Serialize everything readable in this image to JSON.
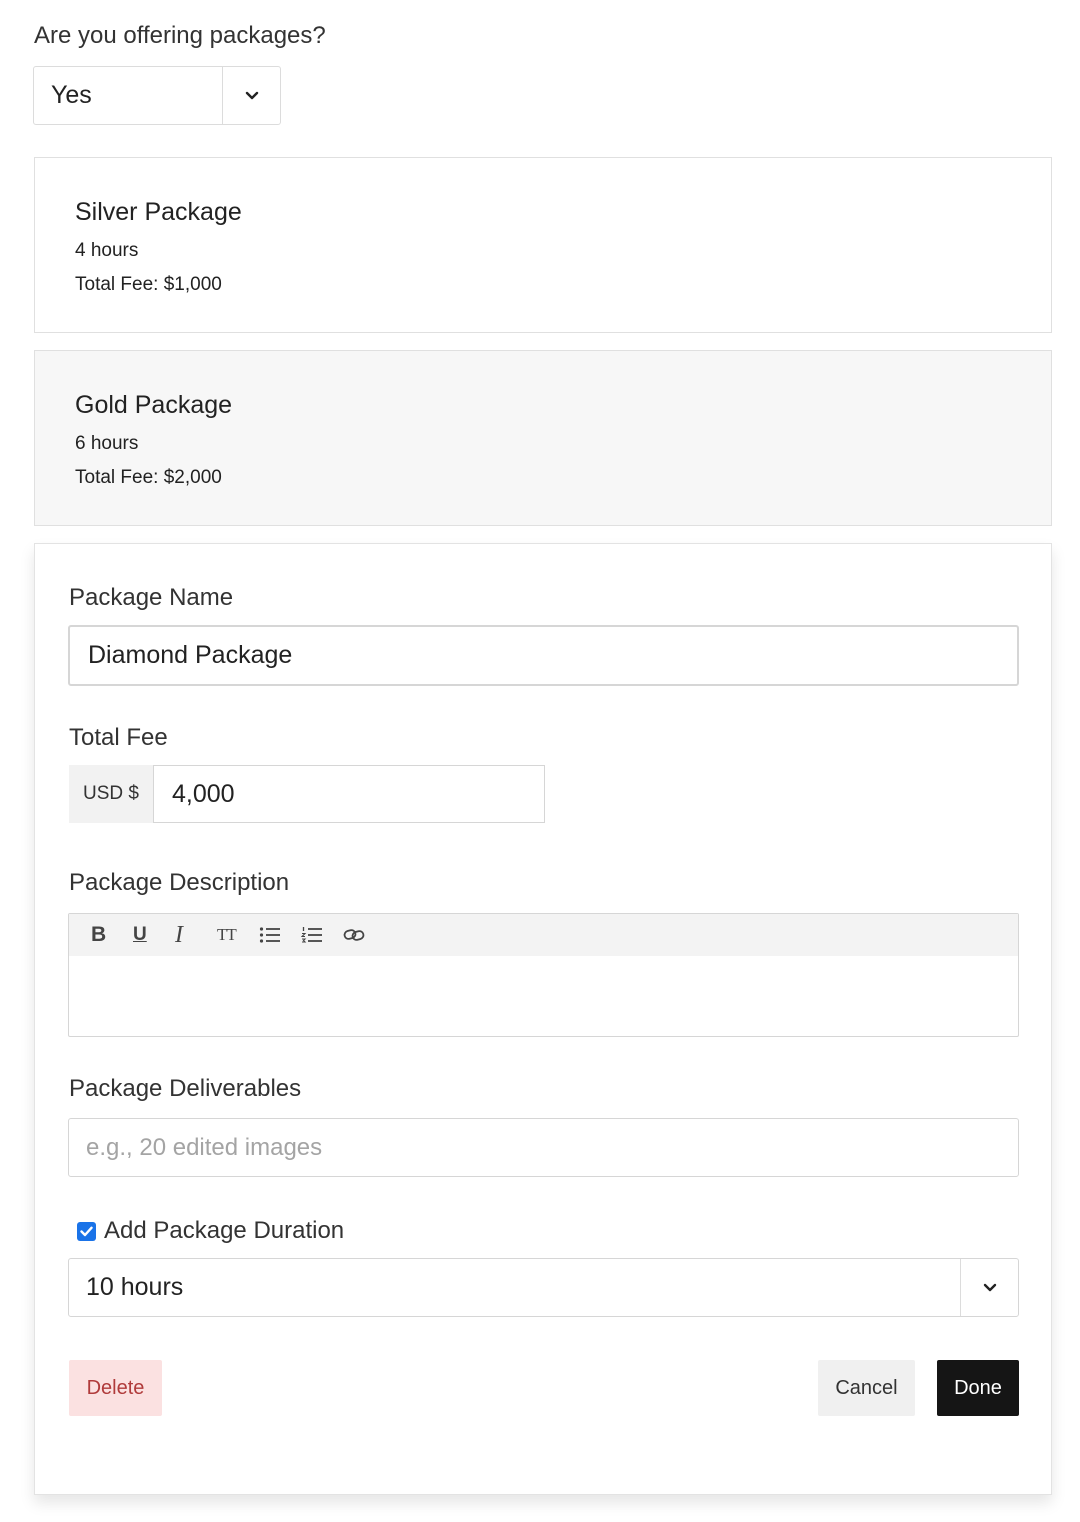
{
  "offering": {
    "question": "Are you offering packages?",
    "selected": "Yes",
    "chevron_icon": "chevron-down-icon"
  },
  "packages": [
    {
      "name": "Silver Package",
      "duration": "4 hours",
      "fee": "Total Fee: $1,000"
    },
    {
      "name": "Gold Package",
      "duration": "6 hours",
      "fee": "Total Fee: $2,000"
    }
  ],
  "editor": {
    "name_label": "Package Name",
    "name_value": "Diamond Package",
    "fee_label": "Total Fee",
    "fee_prefix": "USD $",
    "fee_value": "4,000",
    "description_label": "Package Description",
    "toolbar": {
      "bold": "B",
      "underline": "U",
      "italic": "I",
      "text_size": "TT"
    },
    "deliverables_label": "Package Deliverables",
    "deliverables_placeholder": "e.g., 20 edited images",
    "duration_checkbox_label": "Add Package Duration",
    "duration_checked": true,
    "duration_value": "10 hours",
    "delete_label": "Delete",
    "cancel_label": "Cancel",
    "done_label": "Done"
  },
  "colors": {
    "accent": "#1a73e8",
    "done_bg": "#151515",
    "delete_bg": "#fbe1e1",
    "delete_text": "#b03b3b"
  }
}
